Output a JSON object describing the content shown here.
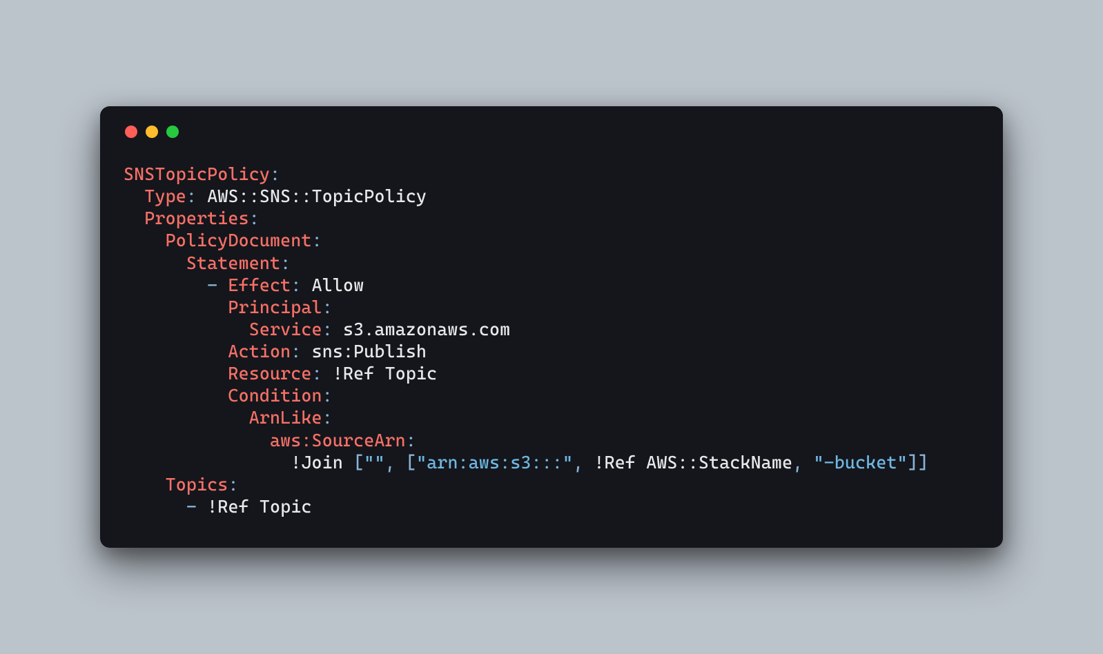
{
  "code": {
    "line1_key": "SNSTopicPolicy",
    "line2_key": "Type",
    "line2_val": "AWS::SNS::TopicPolicy",
    "line3_key": "Properties",
    "line4_key": "PolicyDocument",
    "line5_key": "Statement",
    "line6_key": "Effect",
    "line6_val": "Allow",
    "line7_key": "Principal",
    "line8_key": "Service",
    "line8_val": "s3.amazonaws.com",
    "line9_key": "Action",
    "line9_val": "sns:Publish",
    "line10_key": "Resource",
    "line10_bang": "!Ref",
    "line10_val": "Topic",
    "line11_key": "Condition",
    "line12_key": "ArnLike",
    "line13_key": "aws:SourceArn",
    "line14_bang": "!Join",
    "line14_s1": "\"\"",
    "line14_s2": "\"arn:aws:s3:::\"",
    "line14_bang2": "!Ref",
    "line14_val2": "AWS::StackName",
    "line14_s3": "\"-bucket\"",
    "line15_key": "Topics",
    "line16_bang": "!Ref",
    "line16_val": "Topic",
    "colon": ":",
    "dash": "-",
    "comma": ",",
    "lbrack": "[",
    "rbrack": "]"
  }
}
